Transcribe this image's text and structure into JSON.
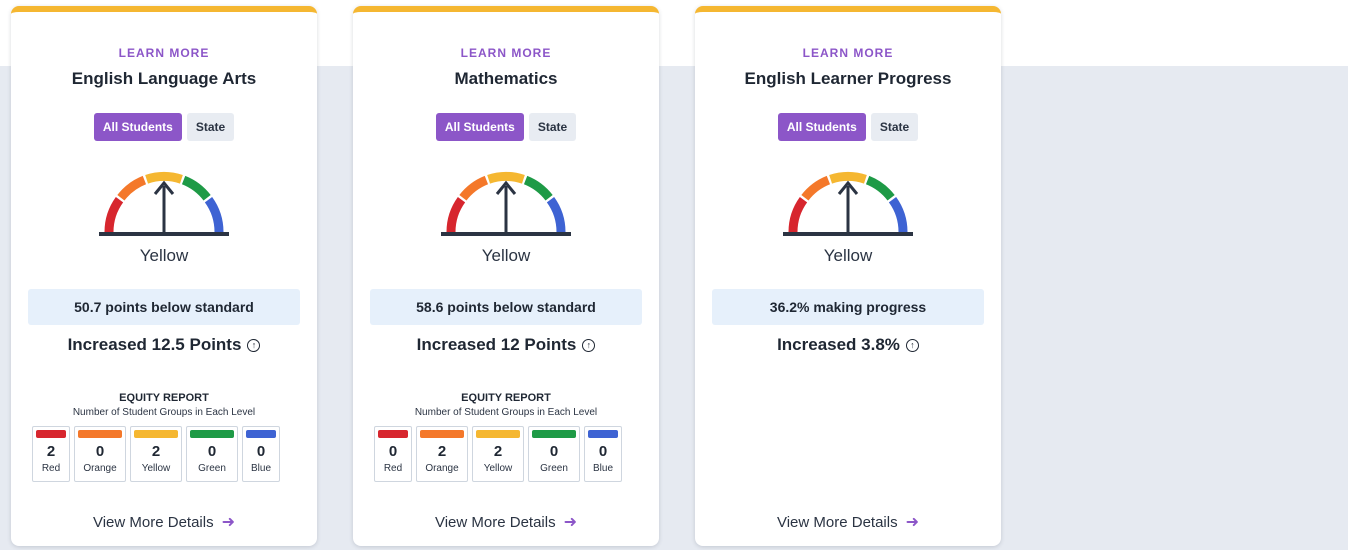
{
  "colors": {
    "accent": "#8c56c8",
    "top_border": "#f5b731",
    "red": "#d7262e",
    "orange": "#f4782a",
    "yellow": "#f5b731",
    "green": "#1e9a46",
    "blue": "#3e63d3",
    "band": "#e6eaf1"
  },
  "cards": [
    {
      "learn_more": "LEARN MORE",
      "title": "English Language Arts",
      "toggle_all": "All Students",
      "toggle_state": "State",
      "level": "Yellow",
      "status": "50.7 points below standard",
      "change": "Increased 12.5 Points",
      "change_icon": "up-circle-icon",
      "equity_title": "EQUITY REPORT",
      "equity_subtitle": "Number of Student Groups in Each Level",
      "equity": [
        {
          "count": "2",
          "name": "Red"
        },
        {
          "count": "0",
          "name": "Orange"
        },
        {
          "count": "2",
          "name": "Yellow"
        },
        {
          "count": "0",
          "name": "Green"
        },
        {
          "count": "0",
          "name": "Blue"
        }
      ],
      "details": "View More Details",
      "details_icon": "arrow-right-icon"
    },
    {
      "learn_more": "LEARN MORE",
      "title": "Mathematics",
      "toggle_all": "All Students",
      "toggle_state": "State",
      "level": "Yellow",
      "status": "58.6 points below standard",
      "change": "Increased 12 Points",
      "change_icon": "up-circle-icon",
      "equity_title": "EQUITY REPORT",
      "equity_subtitle": "Number of Student Groups in Each Level",
      "equity": [
        {
          "count": "0",
          "name": "Red"
        },
        {
          "count": "2",
          "name": "Orange"
        },
        {
          "count": "2",
          "name": "Yellow"
        },
        {
          "count": "0",
          "name": "Green"
        },
        {
          "count": "0",
          "name": "Blue"
        }
      ],
      "details": "View More Details",
      "details_icon": "arrow-right-icon"
    },
    {
      "learn_more": "LEARN MORE",
      "title": "English Learner Progress",
      "toggle_all": "All Students",
      "toggle_state": "State",
      "level": "Yellow",
      "status": "36.2% making progress",
      "change": "Increased 3.8%",
      "change_icon": "up-circle-icon",
      "details": "View More Details",
      "details_icon": "arrow-right-icon"
    }
  ]
}
